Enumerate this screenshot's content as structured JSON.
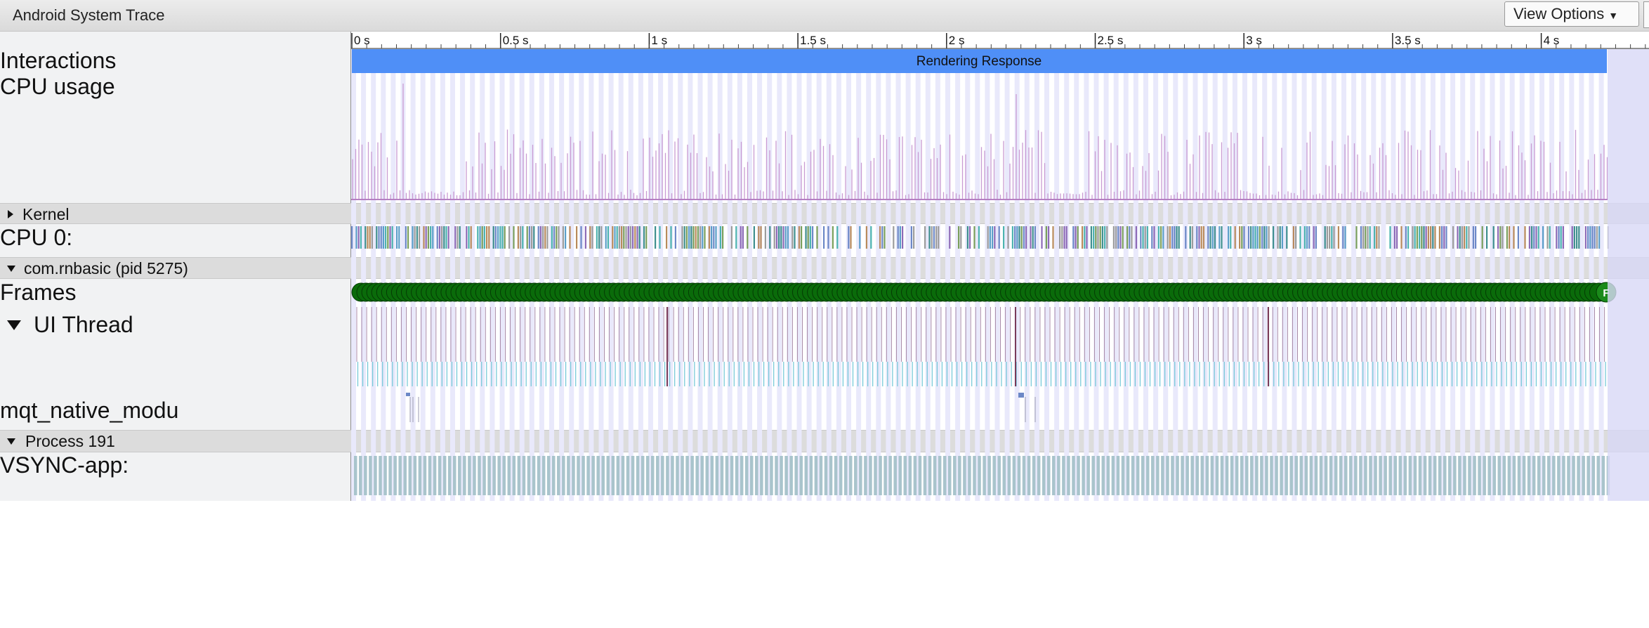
{
  "app": {
    "title": "Android System Trace"
  },
  "toolbar": {
    "view_options_label": "View Options"
  },
  "ruler": {
    "ticks": [
      "0 s",
      "0.5 s",
      "1 s",
      "1.5 s",
      "2 s",
      "2.5 s",
      "3 s",
      "3.5 s",
      "4 s"
    ]
  },
  "tracks": {
    "interactions": {
      "label": "Interactions",
      "event_label": "Rendering Response"
    },
    "cpu_usage": {
      "label": "CPU usage"
    },
    "kernel": {
      "label": "Kernel"
    },
    "cpu0": {
      "label": "CPU 0:"
    },
    "process_rn": {
      "label": "com.rnbasic (pid 5275)"
    },
    "frames": {
      "label": "Frames",
      "last_frame_glyph": "F"
    },
    "ui_thread": {
      "label": "UI Thread"
    },
    "mqt": {
      "label": "mqt_native_modu"
    },
    "process_191": {
      "label": "Process 191"
    },
    "vsync": {
      "label": "VSYNC-app:"
    }
  },
  "colors": {
    "interaction_bar": "#4f8ff7",
    "cpu_usage": "#c99bd3",
    "frame_ok": "#0a6b0a",
    "vsync": "#a9c4cc",
    "selection_shade": "#d8d8f6"
  }
}
